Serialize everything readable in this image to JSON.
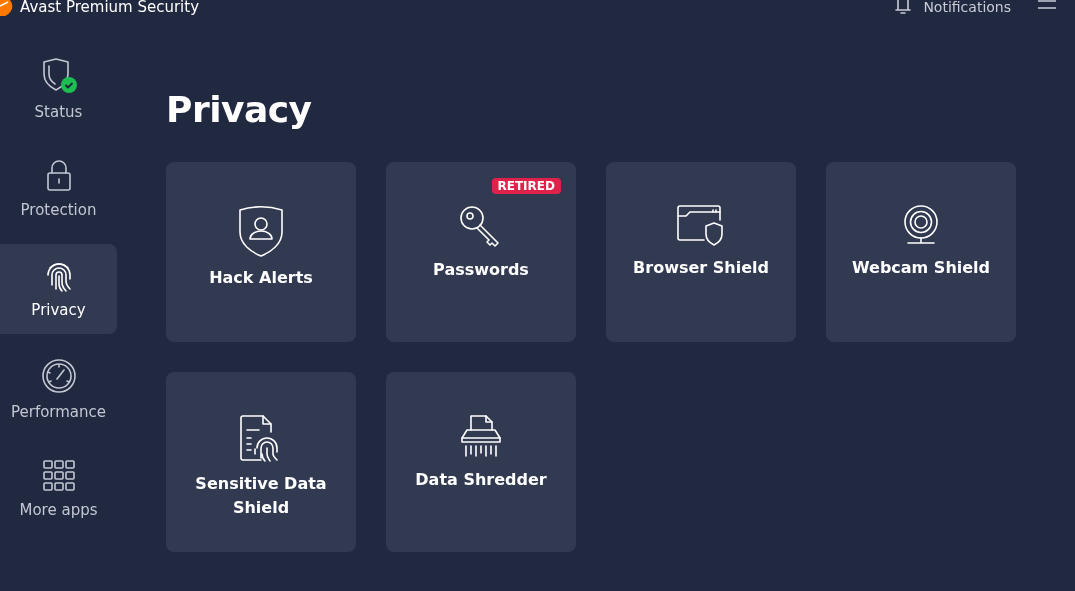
{
  "window": {
    "title": "Avast Premium Security",
    "notifications": "Notifications"
  },
  "sidebar": {
    "items": [
      {
        "label": "Status",
        "selected": false
      },
      {
        "label": "Protection",
        "selected": false
      },
      {
        "label": "Privacy",
        "selected": true
      },
      {
        "label": "Performance",
        "selected": false
      },
      {
        "label": "More apps",
        "selected": false
      }
    ]
  },
  "page": {
    "title": "Privacy"
  },
  "tiles": [
    {
      "label": "Hack Alerts"
    },
    {
      "label": "Passwords",
      "badge": "RETIRED"
    },
    {
      "label": "Browser Shield"
    },
    {
      "label": "Webcam Shield"
    },
    {
      "label": "Sensitive Data Shield"
    },
    {
      "label": "Data Shredder"
    }
  ]
}
